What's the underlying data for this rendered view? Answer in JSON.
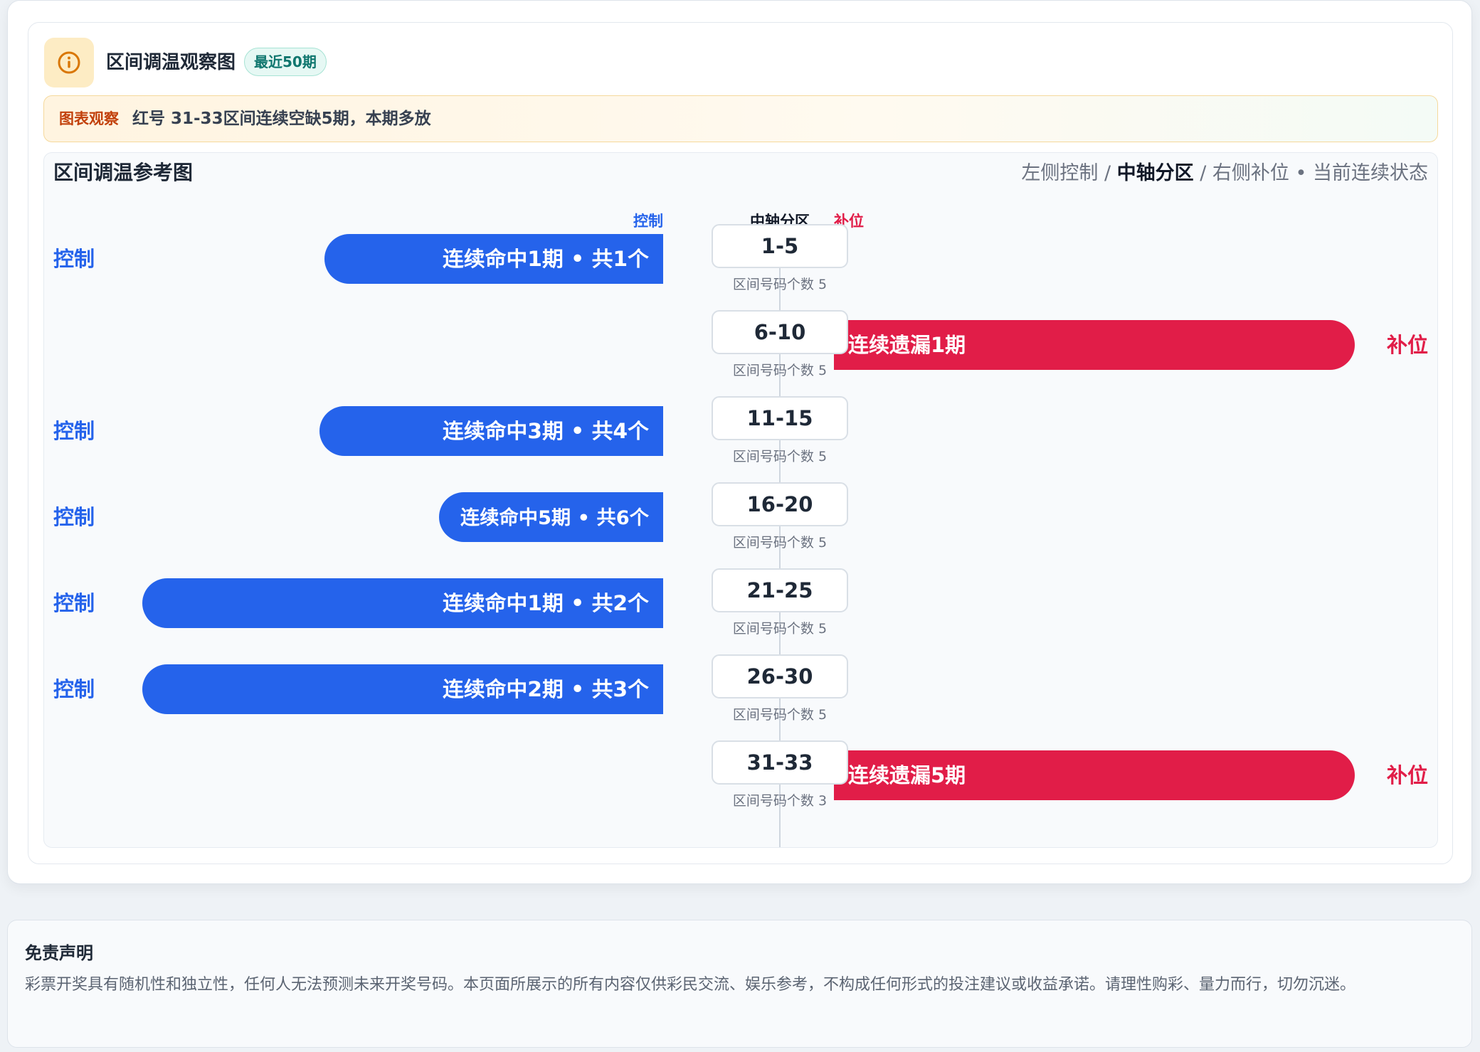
{
  "header": {
    "title": "区间调温观察图",
    "badge": "最近50期",
    "icon": "info-icon",
    "accent": "#d97706"
  },
  "observation": {
    "label": "图表观察",
    "text": "红号 31-33区间连续空缺5期，本期多放"
  },
  "chart_data": {
    "type": "bar",
    "title": "区间调温参考图",
    "legend": {
      "left": "左侧控制",
      "sep1": " / ",
      "center": "中轴分区",
      "sep2": " / ",
      "right": "右侧补位",
      "dot": "•",
      "tail": "当前连续状态"
    },
    "column_headers": {
      "left": "控制",
      "center": "中轴分区",
      "right": "补位"
    },
    "colors": {
      "control": "#2563eb",
      "fill": "#e11d48",
      "axis": "#cfd6df"
    },
    "count_label_prefix": "区间号码个数",
    "categories": [
      "1-5",
      "6-10",
      "11-15",
      "16-20",
      "21-25",
      "26-30",
      "31-33"
    ],
    "zones": [
      {
        "range": "1-5",
        "count": "5",
        "side": "control",
        "side_label": "控制",
        "bar_label": "连续命中1期  •  共1个",
        "value": 0.65
      },
      {
        "range": "6-10",
        "count": "5",
        "side": "fill",
        "side_label": "补位",
        "bar_label": "连续遗漏1期",
        "value": 1.0
      },
      {
        "range": "11-15",
        "count": "5",
        "side": "control",
        "side_label": "控制",
        "bar_label": "连续命中3期  •  共4个",
        "value": 0.66
      },
      {
        "range": "16-20",
        "count": "5",
        "side": "control",
        "side_label": "控制",
        "bar_label": "连续命中5期  •  共6个",
        "value": 0.43
      },
      {
        "range": "21-25",
        "count": "5",
        "side": "control",
        "side_label": "控制",
        "bar_label": "连续命中1期  •  共2个",
        "value": 1.0
      },
      {
        "range": "26-30",
        "count": "5",
        "side": "control",
        "side_label": "控制",
        "bar_label": "连续命中2期  •  共3个",
        "value": 1.0
      },
      {
        "range": "31-33",
        "count": "3",
        "side": "fill",
        "side_label": "补位",
        "bar_label": "连续遗漏5期",
        "value": 1.0
      }
    ]
  },
  "disclaimer": {
    "title": "免责声明",
    "text": "彩票开奖具有随机性和独立性，任何人无法预测未来开奖号码。本页面所展示的所有内容仅供彩民交流、娱乐参考，不构成任何形式的投注建议或收益承诺。请理性购彩、量力而行，切勿沉迷。"
  }
}
